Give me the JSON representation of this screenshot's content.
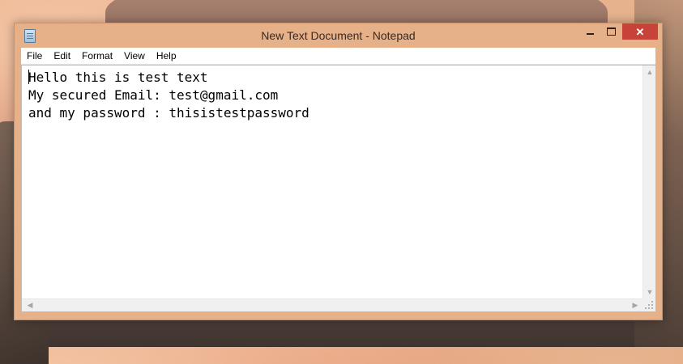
{
  "window": {
    "title": "New Text Document - Notepad",
    "close_glyph": "✕"
  },
  "menu": [
    "File",
    "Edit",
    "Format",
    "View",
    "Help"
  ],
  "document": {
    "lines": [
      "Hello this is test text",
      "My secured Email: test@gmail.com",
      "and my password : thisistestpassword"
    ]
  },
  "scroll": {
    "up": "▲",
    "down": "▼",
    "left": "◀",
    "right": "▶"
  },
  "colors": {
    "window_frame": "#e6b089",
    "close_button": "#c7433a"
  },
  "icons": [
    "notepad-app-icon",
    "minimize-icon",
    "maximize-icon",
    "close-icon",
    "scroll-up-icon",
    "scroll-down-icon",
    "scroll-left-icon",
    "scroll-right-icon",
    "size-grip-icon"
  ]
}
